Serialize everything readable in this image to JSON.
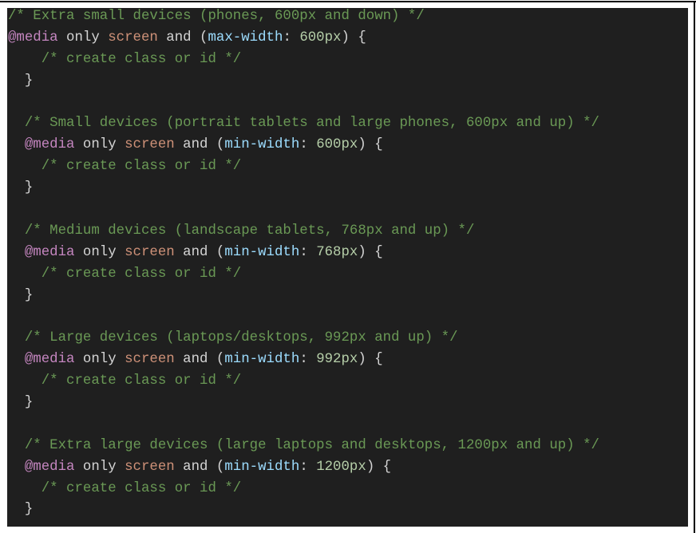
{
  "theme": {
    "background": "#1f1f1f",
    "colors": {
      "comment": "#6a9955",
      "at_rule": "#c586c0",
      "plain": "#d4d4d4",
      "media_type": "#ce9178",
      "property": "#9cdcfe",
      "number": "#b5cea8"
    }
  },
  "code_lines": [
    {
      "tokens": [
        {
          "t": "/* Extra small devices (phones, 600px and down) */",
          "c": "comment"
        }
      ]
    },
    {
      "tokens": [
        {
          "t": "@media",
          "c": "atrule"
        },
        {
          "t": " only ",
          "c": "plain"
        },
        {
          "t": "screen",
          "c": "screen"
        },
        {
          "t": " and (",
          "c": "plain"
        },
        {
          "t": "max-width",
          "c": "prop"
        },
        {
          "t": ": ",
          "c": "plain"
        },
        {
          "t": "600px",
          "c": "num"
        },
        {
          "t": ") {",
          "c": "plain"
        }
      ]
    },
    {
      "tokens": [
        {
          "t": "    ",
          "c": "plain"
        },
        {
          "t": "/* create class or id */",
          "c": "comment"
        }
      ]
    },
    {
      "tokens": [
        {
          "t": "  }",
          "c": "plain"
        }
      ]
    },
    {
      "tokens": [
        {
          "t": "",
          "c": "plain"
        }
      ]
    },
    {
      "tokens": [
        {
          "t": "  ",
          "c": "plain"
        },
        {
          "t": "/* Small devices (portrait tablets and large phones, 600px and up) */",
          "c": "comment"
        }
      ]
    },
    {
      "tokens": [
        {
          "t": "  ",
          "c": "plain"
        },
        {
          "t": "@media",
          "c": "atrule"
        },
        {
          "t": " only ",
          "c": "plain"
        },
        {
          "t": "screen",
          "c": "screen"
        },
        {
          "t": " and (",
          "c": "plain"
        },
        {
          "t": "min-width",
          "c": "prop"
        },
        {
          "t": ": ",
          "c": "plain"
        },
        {
          "t": "600px",
          "c": "num"
        },
        {
          "t": ") {",
          "c": "plain"
        }
      ]
    },
    {
      "tokens": [
        {
          "t": "    ",
          "c": "plain"
        },
        {
          "t": "/* create class or id */",
          "c": "comment"
        }
      ]
    },
    {
      "tokens": [
        {
          "t": "  }",
          "c": "plain"
        }
      ]
    },
    {
      "tokens": [
        {
          "t": "",
          "c": "plain"
        }
      ]
    },
    {
      "tokens": [
        {
          "t": "  ",
          "c": "plain"
        },
        {
          "t": "/* Medium devices (landscape tablets, 768px and up) */",
          "c": "comment"
        }
      ]
    },
    {
      "tokens": [
        {
          "t": "  ",
          "c": "plain"
        },
        {
          "t": "@media",
          "c": "atrule"
        },
        {
          "t": " only ",
          "c": "plain"
        },
        {
          "t": "screen",
          "c": "screen"
        },
        {
          "t": " and (",
          "c": "plain"
        },
        {
          "t": "min-width",
          "c": "prop"
        },
        {
          "t": ": ",
          "c": "plain"
        },
        {
          "t": "768px",
          "c": "num"
        },
        {
          "t": ") {",
          "c": "plain"
        }
      ]
    },
    {
      "tokens": [
        {
          "t": "    ",
          "c": "plain"
        },
        {
          "t": "/* create class or id */",
          "c": "comment"
        }
      ]
    },
    {
      "tokens": [
        {
          "t": "  }",
          "c": "plain"
        }
      ]
    },
    {
      "tokens": [
        {
          "t": "",
          "c": "plain"
        }
      ]
    },
    {
      "tokens": [
        {
          "t": "  ",
          "c": "plain"
        },
        {
          "t": "/* Large devices (laptops/desktops, 992px and up) */",
          "c": "comment"
        }
      ]
    },
    {
      "tokens": [
        {
          "t": "  ",
          "c": "plain"
        },
        {
          "t": "@media",
          "c": "atrule"
        },
        {
          "t": " only ",
          "c": "plain"
        },
        {
          "t": "screen",
          "c": "screen"
        },
        {
          "t": " and (",
          "c": "plain"
        },
        {
          "t": "min-width",
          "c": "prop"
        },
        {
          "t": ": ",
          "c": "plain"
        },
        {
          "t": "992px",
          "c": "num"
        },
        {
          "t": ") {",
          "c": "plain"
        }
      ]
    },
    {
      "tokens": [
        {
          "t": "    ",
          "c": "plain"
        },
        {
          "t": "/* create class or id */",
          "c": "comment"
        }
      ]
    },
    {
      "tokens": [
        {
          "t": "  }",
          "c": "plain"
        }
      ]
    },
    {
      "tokens": [
        {
          "t": "",
          "c": "plain"
        }
      ]
    },
    {
      "tokens": [
        {
          "t": "  ",
          "c": "plain"
        },
        {
          "t": "/* Extra large devices (large laptops and desktops, 1200px and up) */",
          "c": "comment"
        }
      ]
    },
    {
      "tokens": [
        {
          "t": "  ",
          "c": "plain"
        },
        {
          "t": "@media",
          "c": "atrule"
        },
        {
          "t": " only ",
          "c": "plain"
        },
        {
          "t": "screen",
          "c": "screen"
        },
        {
          "t": " and (",
          "c": "plain"
        },
        {
          "t": "min-width",
          "c": "prop"
        },
        {
          "t": ": ",
          "c": "plain"
        },
        {
          "t": "1200px",
          "c": "num"
        },
        {
          "t": ") {",
          "c": "plain"
        }
      ]
    },
    {
      "tokens": [
        {
          "t": "    ",
          "c": "plain"
        },
        {
          "t": "/* create class or id */",
          "c": "comment"
        }
      ]
    },
    {
      "tokens": [
        {
          "t": "  }",
          "c": "plain"
        }
      ]
    }
  ]
}
